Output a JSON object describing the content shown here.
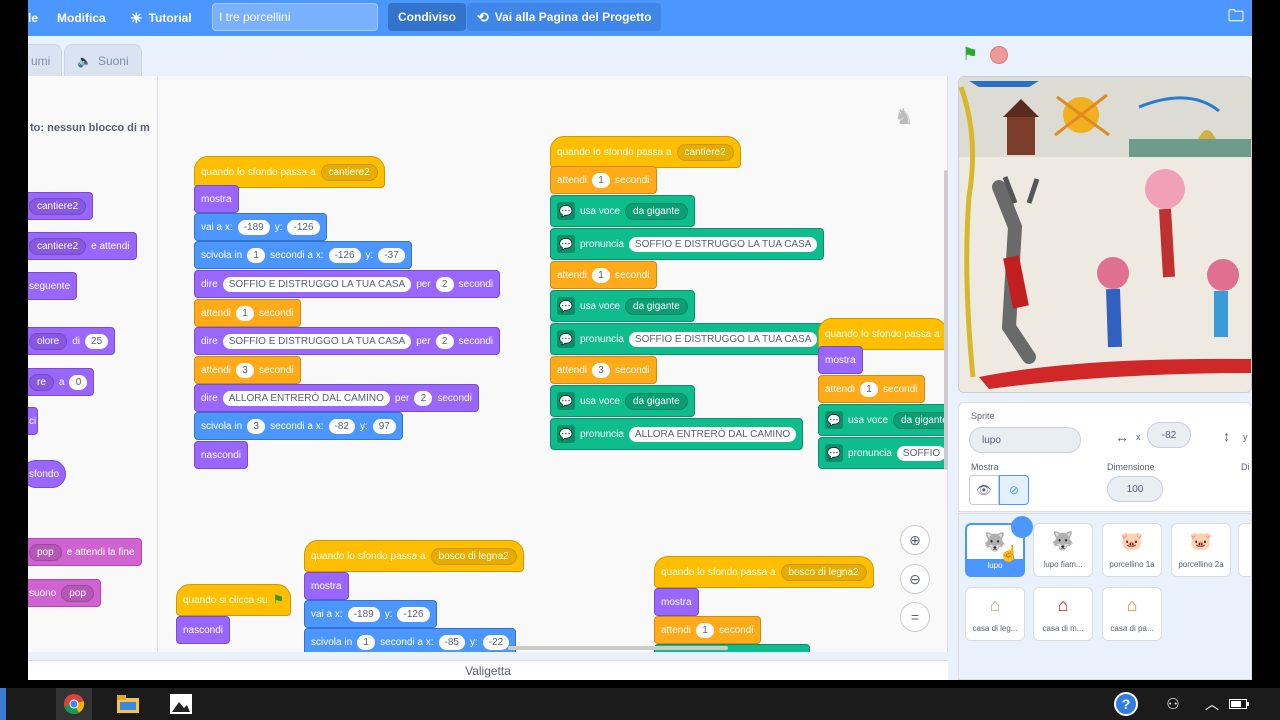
{
  "menu": {
    "file_partial": "le",
    "edit": "Modifica",
    "tutorial": "Tutorial",
    "project_title": "I tre porcellini",
    "shared": "Condiviso",
    "project_page": "Vai alla Pagina del Progetto"
  },
  "tabs": {
    "costumes_partial": "umi",
    "sounds": "Suoni"
  },
  "palette": {
    "warning": "to: nessun blocco di m",
    "backdrop_dd": "cantiere2",
    "backdrop_dd2": "cantiere2",
    "and_wait": "e attendi",
    "next": "seguente",
    "color_dd": "olore",
    "of": "di",
    "color_val": "25",
    "effect_dd": "re",
    "to": "a",
    "effect_val": "0",
    "ci": "ci",
    "backdrop_word": "sfondo",
    "pop_dd": "pop",
    "until_done": "e attendi la fine",
    "sound_word": "suono",
    "pop_dd2": "pop"
  },
  "scripts": {
    "s1": {
      "hat": "quando lo sfondo passa a",
      "hat_dd": "cantiere2",
      "show": "mostra",
      "goto": "vai a x:",
      "goto_x": "-189",
      "y": "y:",
      "goto_y": "-126",
      "glide": "scivola in",
      "glide_s": "1",
      "glide_mid": "secondi a x:",
      "glide_x": "-126",
      "glide_y": "-37",
      "say1": "dire",
      "say1_text": "SOFFIO E DISTRUGGO LA TUA CASA",
      "per": "per",
      "say1_s": "2",
      "seconds": "secondi",
      "wait1": "attendi",
      "wait1_s": "1",
      "say2_text": "SOFFIO E DISTRUGGO LA TUA CASA",
      "say2_s": "2",
      "wait2_s": "3",
      "say3_text": "ALLORA ENTRERÒ DAL CAMINO",
      "say3_s": "2",
      "glide2_s": "3",
      "glide2_x": "-82",
      "glide2_y": "97",
      "hide": "nascondi"
    },
    "s2": {
      "hat": "quando lo sfondo passa a",
      "hat_dd": "cantiere2",
      "wait": "attendi",
      "w1": "1",
      "seconds": "secondi",
      "voice": "usa voce",
      "voice_dd": "da gigante",
      "speak": "pronuncia",
      "t1": "SOFFIO E DISTRUGGO LA TUA CASA",
      "w2": "1",
      "t2": "SOFFIO E DISTRUGGO LA TUA CASA",
      "w3": "3",
      "t3": "ALLORA ENTRERÒ DAL CAMINO"
    },
    "s3": {
      "hat": "quando lo sfondo passa a",
      "show": "mostra",
      "wait": "attendi",
      "w": "1",
      "seconds": "secondi",
      "voice": "usa voce",
      "voice_dd": "da gigante",
      "speak": "pronuncia",
      "t": "SOFFIO"
    },
    "s4": {
      "hat": "quando lo sfondo passa a",
      "hat_dd": "bosco di legna2",
      "show": "mostra",
      "goto": "vai a x:",
      "x": "-189",
      "y": "y:",
      "yv": "-126",
      "glide": "scivola in",
      "gs": "1",
      "gmid": "secondi a x:",
      "gx": "-85",
      "gy": "-22"
    },
    "s5": {
      "hat": "quando si clicca su",
      "hide": "nascondi"
    },
    "s6": {
      "hat": "quando lo sfondo passa a",
      "hat_dd": "bosco di legna2",
      "show": "mostra",
      "wait": "attendi",
      "w": "1",
      "seconds": "secondi"
    }
  },
  "backpack": "Valigetta",
  "sprite_info": {
    "sprite_label": "Sprite",
    "sprite_name": "lupo",
    "x_label": "x",
    "x_value": "-82",
    "y_label": "y",
    "show_label": "Mostra",
    "size_label": "Dimensione",
    "size_value": "100",
    "dir_partial": "Di"
  },
  "sprites": [
    {
      "name": "lupo",
      "icon": "wolf"
    },
    {
      "name": "lupo fiam...",
      "icon": "wolf-fire"
    },
    {
      "name": "porcellino 1a",
      "icon": "pig"
    },
    {
      "name": "porcellino 2a",
      "icon": "pig"
    },
    {
      "name": "casa di leg...",
      "icon": "house-wood"
    },
    {
      "name": "casa di m...",
      "icon": "house-brick"
    },
    {
      "name": "casa di pa...",
      "icon": "house-straw"
    }
  ],
  "colors": {
    "menubar": "#4c97ff",
    "events": "#ffbf00",
    "looks": "#9966ff",
    "motion": "#4c97ff",
    "control": "#ffab19",
    "extension": "#0fbd8c",
    "sound": "#cf63cf"
  }
}
